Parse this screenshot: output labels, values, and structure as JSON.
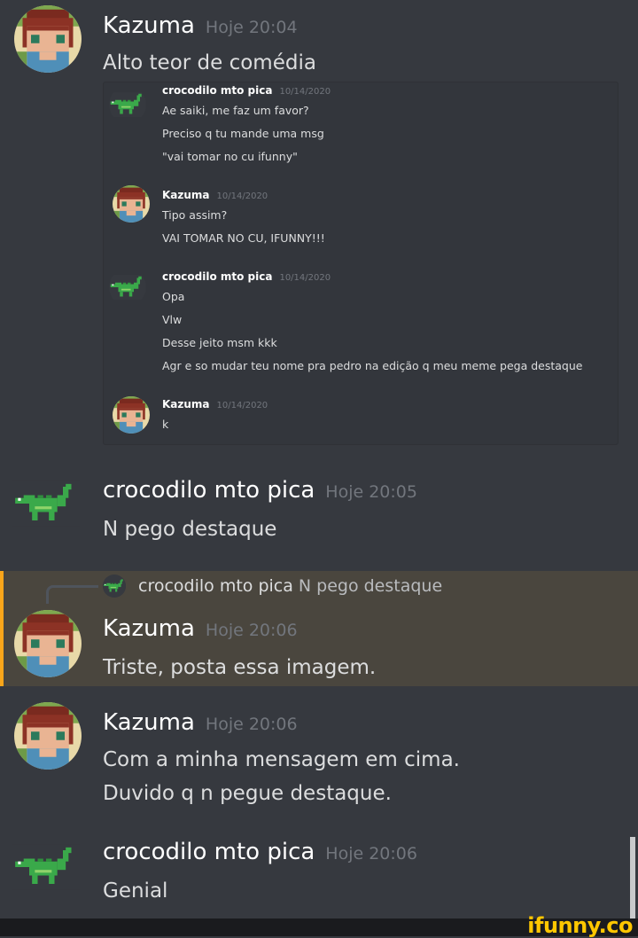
{
  "messages": [
    {
      "author": "Kazuma",
      "time": "Hoje 20:04",
      "lines": [
        "Alto teor de comédia"
      ]
    },
    {
      "author": "crocodilo mto pica",
      "time": "Hoje 20:05",
      "lines": [
        "N pego destaque"
      ]
    },
    {
      "author": "Kazuma",
      "time": "Hoje 20:06",
      "lines": [
        "Triste, posta essa imagem."
      ],
      "reply": {
        "author": "crocodilo mto pica",
        "text": "N pego destaque"
      }
    },
    {
      "author": "Kazuma",
      "time": "Hoje 20:06",
      "lines": [
        "Com a minha mensagem em cima.",
        "Duvido q n pegue destaque."
      ]
    },
    {
      "author": "crocodilo mto pica",
      "time": "Hoje 20:06",
      "lines": [
        "Genial"
      ]
    }
  ],
  "embedded": [
    {
      "author": "crocodilo mto pica",
      "time": "10/14/2020",
      "lines": [
        "Ae saiki, me faz um favor?",
        "Preciso q tu mande uma msg",
        "\"vai tomar no cu ifunny\""
      ]
    },
    {
      "author": "Kazuma",
      "time": "10/14/2020",
      "lines": [
        "Tipo assim?",
        "VAI TOMAR NO CU, IFUNNY!!!"
      ]
    },
    {
      "author": "crocodilo mto pica",
      "time": "10/14/2020",
      "lines": [
        "Opa",
        "Vlw",
        "Desse jeito msm kkk",
        "Agr e so mudar teu nome pra pedro na edição q meu meme pega destaque"
      ]
    },
    {
      "author": "Kazuma",
      "time": "10/14/2020",
      "lines": [
        "k"
      ]
    }
  ],
  "watermark": "ifunny.co",
  "colors": {
    "background": "#36393f",
    "highlight": "#4a463e",
    "highlight_border": "#faa61a",
    "croc": "#3aa94a",
    "watermark": "#ffc700"
  },
  "icons": {
    "kazuma_avatar": "pixel-character-avatar",
    "croc_avatar": "pixel-crocodile-avatar"
  }
}
